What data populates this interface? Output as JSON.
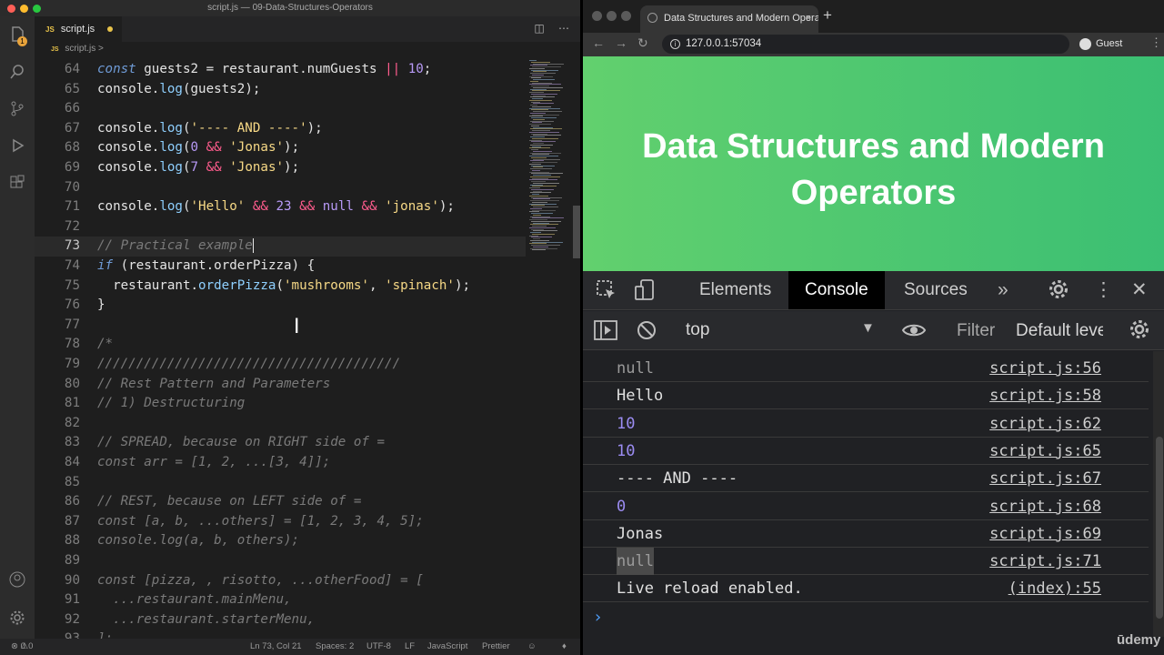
{
  "vscode": {
    "window_title": "script.js — 09-Data-Structures-Operators",
    "tab_label": "script.js",
    "tab_icon": "JS",
    "breadcrumb": "script.js",
    "breadcrumb_sep": ">",
    "explorer_badge": "1",
    "code_lines": [
      {
        "n": "64",
        "tokens": [
          [
            "kw",
            "const"
          ],
          [
            "id",
            " guests2 "
          ],
          [
            "pr",
            "= "
          ],
          [
            "id",
            "restaurant"
          ],
          [
            "pr",
            "."
          ],
          [
            "id",
            "numGuests "
          ],
          [
            "op",
            "||"
          ],
          [
            "num",
            " 10"
          ],
          [
            "pr",
            ";"
          ]
        ]
      },
      {
        "n": "65",
        "tokens": [
          [
            "id",
            "console"
          ],
          [
            "pr",
            "."
          ],
          [
            "fn",
            "log"
          ],
          [
            "pr",
            "("
          ],
          [
            "id",
            "guests2"
          ],
          [
            "pr",
            ");"
          ]
        ]
      },
      {
        "n": "66",
        "tokens": []
      },
      {
        "n": "67",
        "tokens": [
          [
            "id",
            "console"
          ],
          [
            "pr",
            "."
          ],
          [
            "fn",
            "log"
          ],
          [
            "pr",
            "("
          ],
          [
            "str",
            "'---- AND ----'"
          ],
          [
            "pr",
            ");"
          ]
        ]
      },
      {
        "n": "68",
        "tokens": [
          [
            "id",
            "console"
          ],
          [
            "pr",
            "."
          ],
          [
            "fn",
            "log"
          ],
          [
            "pr",
            "("
          ],
          [
            "num",
            "0"
          ],
          [
            "op",
            " && "
          ],
          [
            "str",
            "'Jonas'"
          ],
          [
            "pr",
            ");"
          ]
        ]
      },
      {
        "n": "69",
        "tokens": [
          [
            "id",
            "console"
          ],
          [
            "pr",
            "."
          ],
          [
            "fn",
            "log"
          ],
          [
            "pr",
            "("
          ],
          [
            "num",
            "7"
          ],
          [
            "op",
            " && "
          ],
          [
            "str",
            "'Jonas'"
          ],
          [
            "pr",
            ");"
          ]
        ]
      },
      {
        "n": "70",
        "tokens": []
      },
      {
        "n": "71",
        "tokens": [
          [
            "id",
            "console"
          ],
          [
            "pr",
            "."
          ],
          [
            "fn",
            "log"
          ],
          [
            "pr",
            "("
          ],
          [
            "str",
            "'Hello'"
          ],
          [
            "op",
            " && "
          ],
          [
            "num",
            "23"
          ],
          [
            "op",
            " && "
          ],
          [
            "nul",
            "null"
          ],
          [
            "op",
            " && "
          ],
          [
            "str",
            "'jonas'"
          ],
          [
            "pr",
            ");"
          ]
        ]
      },
      {
        "n": "72",
        "tokens": []
      },
      {
        "n": "73",
        "tokens": [
          [
            "cmt",
            "// Practical example"
          ]
        ],
        "current": true
      },
      {
        "n": "74",
        "tokens": [
          [
            "kw",
            "if"
          ],
          [
            "pr",
            " ("
          ],
          [
            "id",
            "restaurant"
          ],
          [
            "pr",
            "."
          ],
          [
            "id",
            "orderPizza"
          ],
          [
            "pr",
            ") {"
          ]
        ]
      },
      {
        "n": "75",
        "tokens": [
          [
            "id",
            "  restaurant"
          ],
          [
            "pr",
            "."
          ],
          [
            "fn",
            "orderPizza"
          ],
          [
            "pr",
            "("
          ],
          [
            "str",
            "'mushrooms'"
          ],
          [
            "pr",
            ", "
          ],
          [
            "str",
            "'spinach'"
          ],
          [
            "pr",
            ");"
          ]
        ]
      },
      {
        "n": "76",
        "tokens": [
          [
            "pr",
            "}"
          ]
        ]
      },
      {
        "n": "77",
        "tokens": []
      },
      {
        "n": "78",
        "tokens": [
          [
            "cmt",
            "/*"
          ]
        ]
      },
      {
        "n": "79",
        "tokens": [
          [
            "cmt",
            "///////////////////////////////////////"
          ]
        ]
      },
      {
        "n": "80",
        "tokens": [
          [
            "cmt",
            "// Rest Pattern and Parameters"
          ]
        ]
      },
      {
        "n": "81",
        "tokens": [
          [
            "cmt",
            "// 1) Destructuring"
          ]
        ]
      },
      {
        "n": "82",
        "tokens": []
      },
      {
        "n": "83",
        "tokens": [
          [
            "cmt",
            "// SPREAD, because on RIGHT side of ="
          ]
        ]
      },
      {
        "n": "84",
        "tokens": [
          [
            "cmt",
            "const arr = [1, 2, ...[3, 4]];"
          ]
        ]
      },
      {
        "n": "85",
        "tokens": []
      },
      {
        "n": "86",
        "tokens": [
          [
            "cmt",
            "// REST, because on LEFT side of ="
          ]
        ]
      },
      {
        "n": "87",
        "tokens": [
          [
            "cmt",
            "const [a, b, ...others] = [1, 2, 3, 4, 5];"
          ]
        ]
      },
      {
        "n": "88",
        "tokens": [
          [
            "cmt",
            "console.log(a, b, others);"
          ]
        ]
      },
      {
        "n": "89",
        "tokens": []
      },
      {
        "n": "90",
        "tokens": [
          [
            "cmt",
            "const [pizza, , risotto, ...otherFood] = ["
          ]
        ]
      },
      {
        "n": "91",
        "tokens": [
          [
            "cmt",
            "  ...restaurant.mainMenu,"
          ]
        ]
      },
      {
        "n": "92",
        "tokens": [
          [
            "cmt",
            "  ...restaurant.starterMenu,"
          ]
        ]
      },
      {
        "n": "93",
        "tokens": [
          [
            "cmt",
            "];"
          ]
        ]
      }
    ],
    "status": {
      "errors": "0",
      "warnings": "0",
      "position": "Ln 73, Col 21",
      "spaces": "Spaces: 2",
      "encoding": "UTF-8",
      "eol": "LF",
      "language": "JavaScript",
      "formatter": "Prettier"
    }
  },
  "browser": {
    "tab_title": "Data Structures and Modern Operators",
    "url": "127.0.0.1:57034",
    "profile": "Guest",
    "page_heading": "Data Structures and Modern Operators",
    "devtools": {
      "tabs": [
        "Elements",
        "Console",
        "Sources"
      ],
      "active_tab": "Console",
      "context": "top",
      "filter_placeholder": "Filter",
      "levels": "Default levels",
      "logs": [
        {
          "msg": "null",
          "src": "script.js:56",
          "kind": "nul"
        },
        {
          "msg": "Hello",
          "src": "script.js:58",
          "kind": "str"
        },
        {
          "msg": "10",
          "src": "script.js:62",
          "kind": "num"
        },
        {
          "msg": "10",
          "src": "script.js:65",
          "kind": "num"
        },
        {
          "msg": "---- AND ----",
          "src": "script.js:67",
          "kind": "str"
        },
        {
          "msg": "0",
          "src": "script.js:68",
          "kind": "num"
        },
        {
          "msg": "Jonas",
          "src": "script.js:69",
          "kind": "str"
        },
        {
          "msg": "null",
          "src": "script.js:71",
          "kind": "nul-hl"
        },
        {
          "msg": "Live reload enabled.",
          "src": "(index):55",
          "kind": "str"
        }
      ]
    }
  },
  "watermark": "ūdemy",
  "colors": {
    "banner_left": "#62d06e",
    "banner_right": "#3bbf73",
    "editor_bg": "#1e1e1e",
    "devtools_bg": "#202124"
  }
}
